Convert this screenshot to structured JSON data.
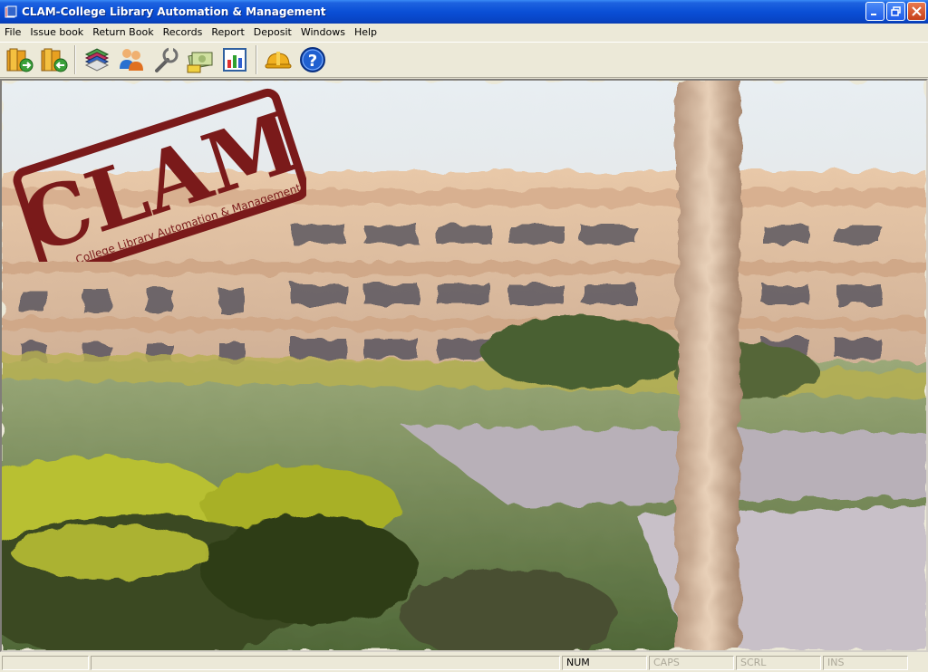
{
  "window": {
    "title": "CLAM-College Library Automation & Management"
  },
  "menu": [
    "File",
    "Issue book",
    "Return Book",
    "Records",
    "Report",
    "Deposit",
    "Windows",
    "Help"
  ],
  "toolbar": {
    "icons": [
      "issue-books-icon",
      "return-books-icon",
      "book-records-icon",
      "members-icon",
      "tools-icon",
      "deposit-icon",
      "report-chart-icon",
      "construction-helmet-icon",
      "help-icon"
    ]
  },
  "logo": {
    "main": "CLAM",
    "sub": "College Library Automation & Management"
  },
  "statusbar": {
    "panels": [
      "",
      "",
      "NUM",
      "CAPS",
      "SCRL",
      "INS"
    ]
  },
  "colors": {
    "title_blue": "#0a4fd6",
    "logo_red": "#7a1a1a"
  }
}
